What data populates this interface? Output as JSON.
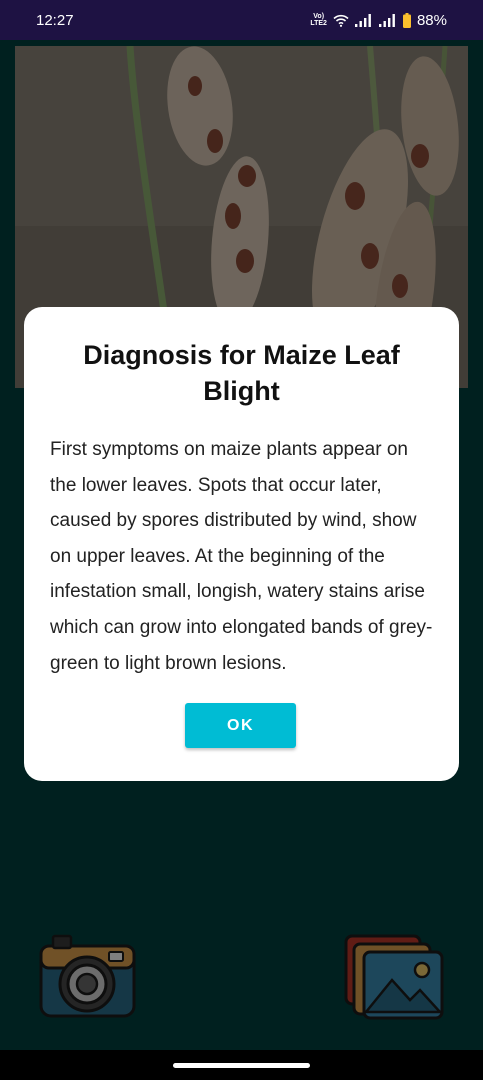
{
  "status_bar": {
    "time": "12:27",
    "volte_line1": "Vo)",
    "volte_line2": "LTE2",
    "battery": "88%",
    "icons": [
      "volte-icon",
      "wifi-icon",
      "signal-icon",
      "signal-icon",
      "battery-icon"
    ]
  },
  "main": {
    "photo_icon": "maize-leaf-photo",
    "camera_button_icon": "camera-icon",
    "gallery_button_icon": "gallery-icon"
  },
  "dialog": {
    "title": "Diagnosis for Maize Leaf Blight",
    "body": "First symptoms on maize plants appear on the lower leaves. Spots that occur later, caused by spores distributed by wind, show on upper leaves. At the beginning of the infestation small, longish, watery stains arise which can grow into elongated bands of grey-green to light brown lesions.",
    "ok_label": "OK"
  },
  "colors": {
    "status_bar": "#1e1243",
    "app_background": "#01403f",
    "ok_button": "#00bcd4",
    "dialog_background": "#ffffff"
  }
}
